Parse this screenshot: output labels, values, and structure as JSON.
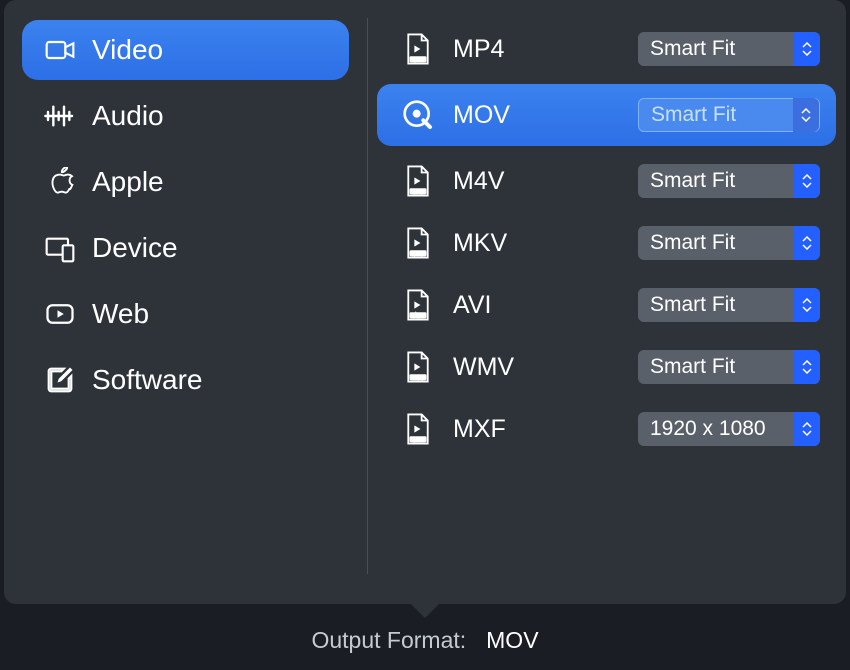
{
  "sidebar": {
    "items": [
      {
        "label": "Video",
        "icon": "video-camera-icon",
        "selected": true
      },
      {
        "label": "Audio",
        "icon": "audio-waveform-icon",
        "selected": false
      },
      {
        "label": "Apple",
        "icon": "apple-logo-icon",
        "selected": false
      },
      {
        "label": "Device",
        "icon": "devices-icon",
        "selected": false
      },
      {
        "label": "Web",
        "icon": "play-box-icon",
        "selected": false
      },
      {
        "label": "Software",
        "icon": "edit-square-icon",
        "selected": false
      }
    ]
  },
  "formats": [
    {
      "label": "MP4",
      "icon": "mp4-file-icon",
      "resolution": "Smart Fit",
      "selected": false
    },
    {
      "label": "MOV",
      "icon": "quicktime-icon",
      "resolution": "Smart Fit",
      "selected": true
    },
    {
      "label": "M4V",
      "icon": "m4v-file-icon",
      "resolution": "Smart Fit",
      "selected": false
    },
    {
      "label": "MKV",
      "icon": "mkv-file-icon",
      "resolution": "Smart Fit",
      "selected": false
    },
    {
      "label": "AVI",
      "icon": "avi-file-icon",
      "resolution": "Smart Fit",
      "selected": false
    },
    {
      "label": "WMV",
      "icon": "wmv-file-icon",
      "resolution": "Smart Fit",
      "selected": false
    },
    {
      "label": "MXF",
      "icon": "mxf-file-icon",
      "resolution": "1920 x 1080",
      "selected": false
    }
  ],
  "footer": {
    "label": "Output Format:",
    "value": "MOV"
  }
}
